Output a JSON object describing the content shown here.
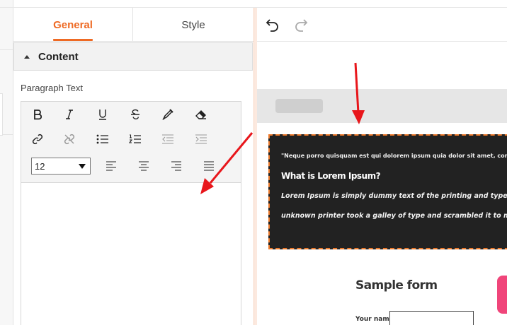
{
  "tabs": {
    "general": "General",
    "style": "Style"
  },
  "section": {
    "title": "Content"
  },
  "paragraph": {
    "label": "Paragraph Text"
  },
  "toolbar": {
    "font_size": "12",
    "icons": [
      "bold-icon",
      "italic-icon",
      "underline-icon",
      "strikethrough-icon",
      "text-color-icon",
      "eraser-icon",
      "link-icon",
      "unlink-icon",
      "bulleted-list-icon",
      "numbered-list-icon",
      "outdent-icon",
      "indent-icon",
      "align-left-icon",
      "align-center-icon",
      "align-right-icon",
      "align-justify-icon"
    ]
  },
  "canvas": {
    "line1": "\"Neque porro quisquam est qui dolorem ipsum quia dolor sit amet, consectetur, adi",
    "heading": "What is Lorem Ipsum?",
    "line3": "Lorem Ipsum is simply dummy text of the printing and typesetting indus",
    "line4": "unknown printer took a galley of type and scrambled it to make a type s",
    "form_title": "Sample form",
    "name_label": "Your name"
  },
  "colors": {
    "accent": "#ee6a24",
    "dark_box": "#222222",
    "arrow": "#e8161b",
    "pink": "#f0457a"
  }
}
